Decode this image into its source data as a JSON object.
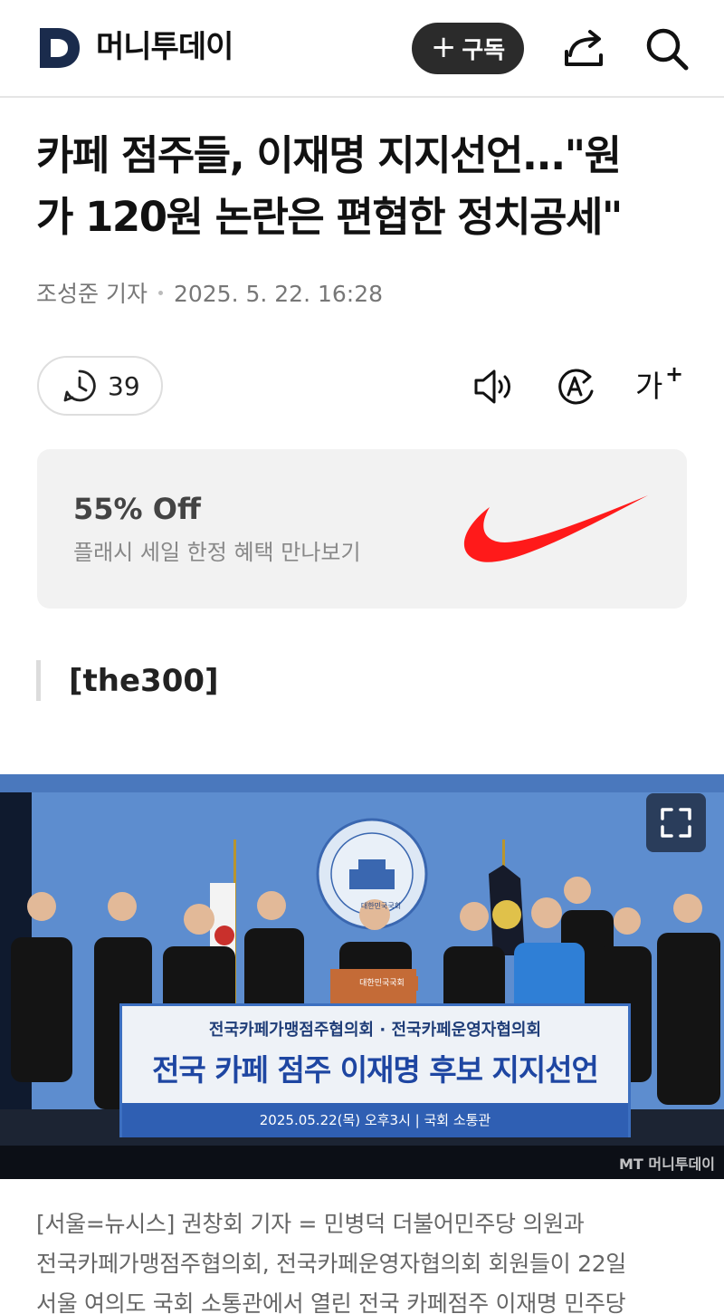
{
  "header": {
    "logo_text": "머니투데이",
    "subscribe_label": "구독",
    "subscribe_plus": "+"
  },
  "article": {
    "title_line1": "카페 점주들, 이재명 지지선언...\"원",
    "title_line2": "가 120원 논란은 편협한 정치공세\"",
    "author": "조성준 기자",
    "datetime": "2025. 5. 22. 16:28",
    "comment_count": "39",
    "section_tag": "[the300]"
  },
  "toolbar": {
    "font_size_label": "가"
  },
  "ad": {
    "title": "55% Off",
    "subtitle": "플래시 세일 한정 혜택 만나보기",
    "swoosh_color": "#ff1a1a"
  },
  "photo": {
    "banner_top": "전국카페가맹점주협의회 · 전국카페운영자협의회",
    "banner_main": "전국 카페 점주 이재명 후보 지지선언",
    "banner_date": "2025.05.22(목) 오후3시 | 국회 소통관",
    "podium_sign": "대한민국국회",
    "seal_text": "대한민국국회",
    "credit": "MT 머니투데이"
  },
  "caption": {
    "line1": "[서울=뉴시스] 권창회 기자 = 민병덕 더불어민주당 의원과",
    "line2": "전국카페가맹점주협의회, 전국카페운영자협의회 회원들이 22일",
    "line3": "서울 여의도 국회 소통관에서 열린 전국 카페점주 이재명 민주당"
  },
  "colors": {
    "logo": "#1a2b4c",
    "subscribe_bg": "#2b2b2b",
    "ad_bg": "#f2f2f2",
    "photo_backdrop": "#5f8fd0"
  }
}
